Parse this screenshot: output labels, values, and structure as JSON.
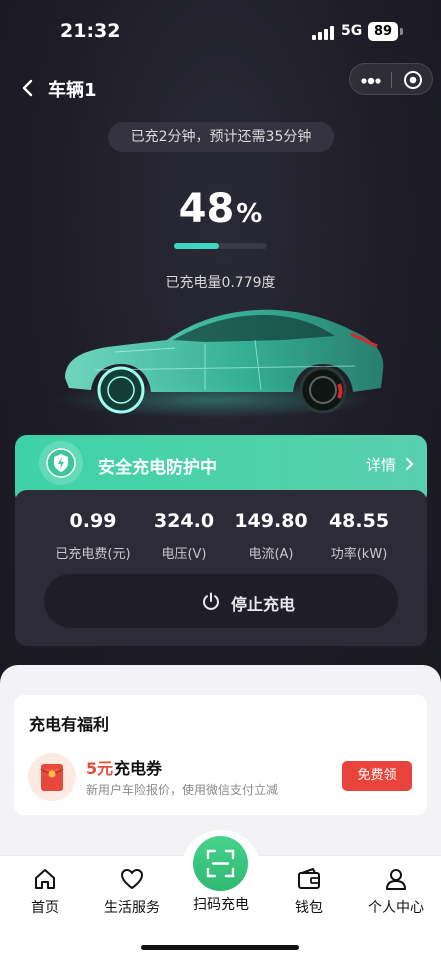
{
  "status_bar": {
    "time": "21:32",
    "network": "5G",
    "battery": "89"
  },
  "nav": {
    "title": "车辆1"
  },
  "charging": {
    "time_info": "已充2分钟，预计还需35分钟",
    "percent": "48",
    "percent_unit": "%",
    "progress_fraction": 0.48,
    "energy_text": "已充电量0.779度"
  },
  "safety": {
    "text": "安全充电防护中",
    "detail_label": "详情"
  },
  "stats": [
    {
      "value": "0.99",
      "label": "已充电费(元)"
    },
    {
      "value": "324.0",
      "label": "电压(V)"
    },
    {
      "value": "149.80",
      "label": "电流(A)"
    },
    {
      "value": "48.55",
      "label": "功率(kW)"
    }
  ],
  "stop_button": {
    "label": "停止充电"
  },
  "benefits": {
    "title": "充电有福利",
    "coupon_amount": "5元",
    "coupon_name": "充电券",
    "coupon_desc": "新用户车险报价，使用微信支付立减",
    "claim_label": "免费领"
  },
  "tabbar": {
    "items": [
      {
        "label": "首页",
        "icon": "home-icon"
      },
      {
        "label": "生活服务",
        "icon": "heart-icon"
      },
      {
        "label": "扫码充电",
        "icon": "scan-icon"
      },
      {
        "label": "钱包",
        "icon": "wallet-icon"
      },
      {
        "label": "个人中心",
        "icon": "user-icon"
      }
    ]
  },
  "colors": {
    "accent": "#3fd7c4",
    "safety_green": "#4fd3a8",
    "scan_green": "#2eb871",
    "claim_red": "#e9443b"
  }
}
